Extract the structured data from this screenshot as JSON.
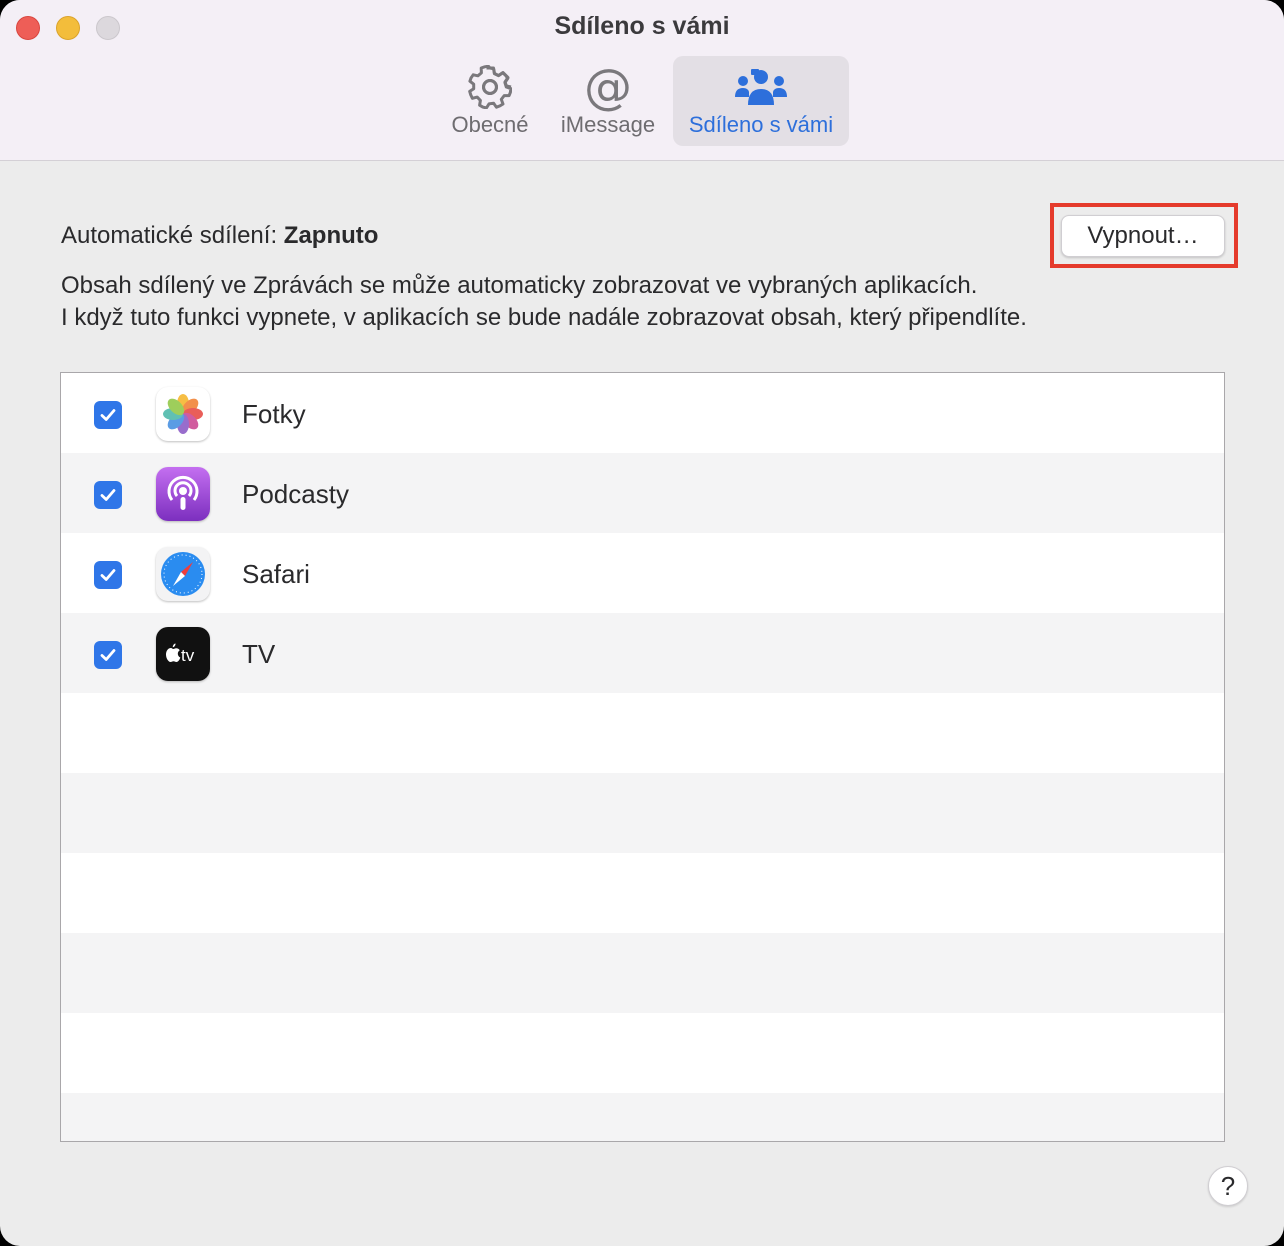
{
  "window": {
    "title": "Sdíleno s vámi"
  },
  "toolbar": {
    "tabs": [
      {
        "label": "Obecné",
        "icon": "gear-icon",
        "selected": false
      },
      {
        "label": "iMessage",
        "icon": "at-sign-icon",
        "selected": false
      },
      {
        "label": "Sdíleno s vámi",
        "icon": "people-icon",
        "selected": true
      }
    ],
    "at_symbol": "@"
  },
  "content": {
    "auto_sharing_label": "Automatické sdílení:",
    "auto_sharing_status": "Zapnuto",
    "turn_off_button": "Vypnout…",
    "description_line1": "Obsah sdílený ve Zprávách se může automaticky zobrazovat ve vybraných aplikacích.",
    "description_line2": "I když tuto funkci vypnete, v aplikacích se bude nadále zobrazovat obsah, který připendlíte."
  },
  "apps": [
    {
      "name": "Fotky",
      "checked": true,
      "icon": "photos-icon"
    },
    {
      "name": "Podcasty",
      "checked": true,
      "icon": "podcasts-icon"
    },
    {
      "name": "Safari",
      "checked": true,
      "icon": "safari-icon"
    },
    {
      "name": "TV",
      "checked": true,
      "icon": "apple-tv-icon",
      "icon_text": "tv"
    }
  ],
  "help_button": "?",
  "colors": {
    "accent": "#2d6fdb",
    "checkbox": "#2f76e8",
    "highlight": "#e53b2c"
  }
}
